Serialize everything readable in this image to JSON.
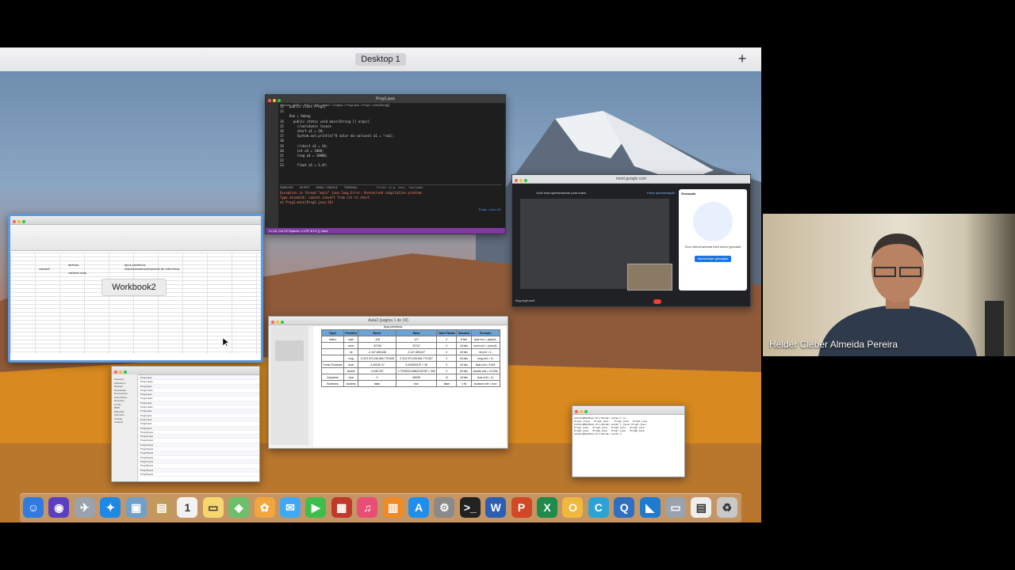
{
  "spaces": {
    "desktop_label": "Desktop 1",
    "add_label": "+"
  },
  "vscode": {
    "title": "Prog1.java",
    "breadcrumb": "Volumes > IBSD > 2022-2 > PM > Aula2 > Codigos > Prog1.java > Prog1 > main(String[])",
    "code_lines": [
      "12   public class Prog1{",
      "13",
      "     Run | Debug",
      "14     public static void main(String [] args){",
      "15       //variáveis locais",
      "16       short a1 = 20;",
      "17       System.out.println(\"O valor da variavel a1 = \"+a1);",
      "18",
      "19       //short a2 = 34;",
      "20       int a3 = 1000;",
      "21       long a4 = 10000;",
      "22",
      "23       float a5 = 3.4f;"
    ],
    "panel_tabs": [
      "PROBLEMS",
      "OUTPUT",
      "DEBUG CONSOLE",
      "TERMINAL"
    ],
    "panel_filter": "Filter (e.g. text, !exclude)",
    "panel_lines": [
      "Exception in thread \"main\" java.lang.Error: Unresolved compilation problem:",
      "      Type mismatch: cannot convert from int to short",
      "",
      "      at Prog1.main(Prog1.java:16)"
    ],
    "panel_link": "Prog1.java:16",
    "status_text": "Ln 16, Col 22   Spaces: 4   UTF-8   LF   {} Java"
  },
  "excel": {
    "cells": [
      {
        "text": "atributo",
        "col": "c"
      },
      {
        "text": "tipos primitivos",
        "col": "e"
      },
      {
        "text": "variável",
        "col": "a"
      },
      {
        "text": "objetos/instancia/variavel de referência",
        "col": "e"
      },
      {
        "text": "variável local",
        "col": "c"
      }
    ],
    "workbook_label": "Workbook2"
  },
  "meet": {
    "url": "meet.google.com",
    "presenting_label": "Você está apresentando para todos",
    "stop_label": "Parar apresentação",
    "side_title": "Gravação",
    "side_text": "Sua videochamada está sendo gravada",
    "side_button": "Interromper gravação",
    "bottom_code": "hbg-mgh-wxd"
  },
  "pages_table": {
    "title": "Aula2 (página 1 de 19)",
    "caption": "tipos primitivos",
    "headers": [
      "Tipos",
      "Primitivo",
      "Menor",
      "Maior",
      "Valor Padrão",
      "Tamanho",
      "Exemplo"
    ],
    "rows": [
      [
        "Inteiro",
        "byte",
        "-128",
        "127",
        "0",
        "8 bits",
        "byte ex1 = (byte)1;"
      ],
      [
        "",
        "short",
        "-32768",
        "32767",
        "0",
        "16 bits",
        "short ex2 = (short)1;"
      ],
      [
        "",
        "int",
        "-2.147.483.648",
        "2.147.483.647",
        "0",
        "32 bits",
        "int ex3 = 1;"
      ],
      [
        "",
        "long",
        "-9.223.372.036.854.775.808",
        "9.223.372.036.854.775.807",
        "0",
        "64 bits",
        "long ex4 = 1l;"
      ],
      [
        "Ponto Flutuante",
        "float",
        "-1,4024E-37",
        "3.40282347E + 38",
        "0",
        "32 bits",
        "float ex5 = 5.50f;"
      ],
      [
        "",
        "double",
        "-4,94E-307",
        "1.79769313486231570E + 308",
        "0",
        "64 bits",
        "double ex6 = 10.20d;"
      ],
      [
        "Caractere",
        "char",
        "0",
        "65535",
        "\\0",
        "16 bits",
        "char ex8 = 'a';"
      ],
      [
        "Booleano",
        "boolean",
        "false",
        "true",
        "false",
        "1 bit",
        "boolean ex9 = true;"
      ]
    ]
  },
  "finder": {
    "sidebar": [
      "Favoritos",
      "Aplicativos",
      "Desktop",
      "Downloads",
      "Documentos",
      "iCloud Drive",
      "Recentes",
      "Locais",
      "IBSD",
      "Etiquetas",
      "Vermelho",
      "Laranja",
      "Amarelo"
    ],
    "files": [
      "Prog1.java",
      "Prog1.class",
      "Prog2.java",
      "Prog2.class",
      "Prog3.java",
      "Prog3.class",
      "Prog4.java",
      "Prog4.class",
      "Prog5.java",
      "Prog6.java",
      "Prog7.java",
      "Prog8.java",
      "Prog9.java",
      "Prog10.java",
      "Prog11.java",
      "Prog12.java",
      "Prog13.java",
      "Prog14.java",
      "Prog15.java",
      "Prog16.java",
      "Prog17.java",
      "Prog18.java",
      "Prog19.java",
      "Prog20.java"
    ]
  },
  "terminal": {
    "lines": [
      "helder@MacBook-Pro-Helder Aula2 % ls",
      "Prog1.class   Prog1.java    Prog2.java   Prog3.java",
      "helder@MacBook-Pro-Helder Aula2 % javac Prog1.java",
      "Prog1.java   Prog2.java   Prog3.java   Prog4.java",
      "Prog5.java   Prog6.java   Prog7.java   Prog8.java",
      "helder@MacBook-Pro-Helder Aula2 %"
    ]
  },
  "dock": {
    "icons": [
      {
        "name": "finder-icon",
        "glyph": "☺",
        "color": "#2f7be0"
      },
      {
        "name": "siri-icon",
        "glyph": "◉",
        "color": "#5a3fc0"
      },
      {
        "name": "launchpad-icon",
        "glyph": "✈",
        "color": "#9aa3ad"
      },
      {
        "name": "safari-icon",
        "glyph": "✦",
        "color": "#1e88e5"
      },
      {
        "name": "preview-icon",
        "glyph": "▣",
        "color": "#6fa0c9"
      },
      {
        "name": "notes-icon",
        "glyph": "▤",
        "color": "#c29a5a"
      },
      {
        "name": "calendar-icon",
        "glyph": "1",
        "color": "#f2f2f2"
      },
      {
        "name": "stickies-icon",
        "glyph": "▭",
        "color": "#f5d76e"
      },
      {
        "name": "maps-icon",
        "glyph": "◈",
        "color": "#6cbf6c"
      },
      {
        "name": "photos-icon",
        "glyph": "✿",
        "color": "#f3a63b"
      },
      {
        "name": "messages-icon",
        "glyph": "✉",
        "color": "#3fa9f5"
      },
      {
        "name": "facetime-icon",
        "glyph": "▶",
        "color": "#3cbf4a"
      },
      {
        "name": "photobooth-icon",
        "glyph": "▦",
        "color": "#c0392b"
      },
      {
        "name": "music-icon",
        "glyph": "♫",
        "color": "#e94e77"
      },
      {
        "name": "books-icon",
        "glyph": "▥",
        "color": "#f08a24"
      },
      {
        "name": "appstore-icon",
        "glyph": "A",
        "color": "#1f8ef1"
      },
      {
        "name": "settings-icon",
        "glyph": "⚙",
        "color": "#8a8a8a"
      },
      {
        "name": "terminal-icon",
        "glyph": ">_",
        "color": "#222222"
      },
      {
        "name": "word-icon",
        "glyph": "W",
        "color": "#2b5fb4"
      },
      {
        "name": "powerpoint-icon",
        "glyph": "P",
        "color": "#d24726"
      },
      {
        "name": "excel-icon",
        "glyph": "X",
        "color": "#1f8a4c"
      },
      {
        "name": "onenote-icon",
        "glyph": "O",
        "color": "#f0b83c"
      },
      {
        "name": "chrome-c-icon",
        "glyph": "C",
        "color": "#2aa3d6"
      },
      {
        "name": "search-browser-icon",
        "glyph": "Q",
        "color": "#2e6fc2"
      },
      {
        "name": "vscode-icon",
        "glyph": "◣",
        "color": "#1e7bd0"
      },
      {
        "name": "screen-capture-icon",
        "glyph": "▭",
        "color": "#9aa3ad"
      },
      {
        "name": "document-icon",
        "glyph": "▤",
        "color": "#eeeeee"
      },
      {
        "name": "trash-icon",
        "glyph": "♻",
        "color": "#c8c8c8"
      }
    ]
  },
  "webcam": {
    "speaker_name": "Helder Cleber Almeida Pereira"
  }
}
